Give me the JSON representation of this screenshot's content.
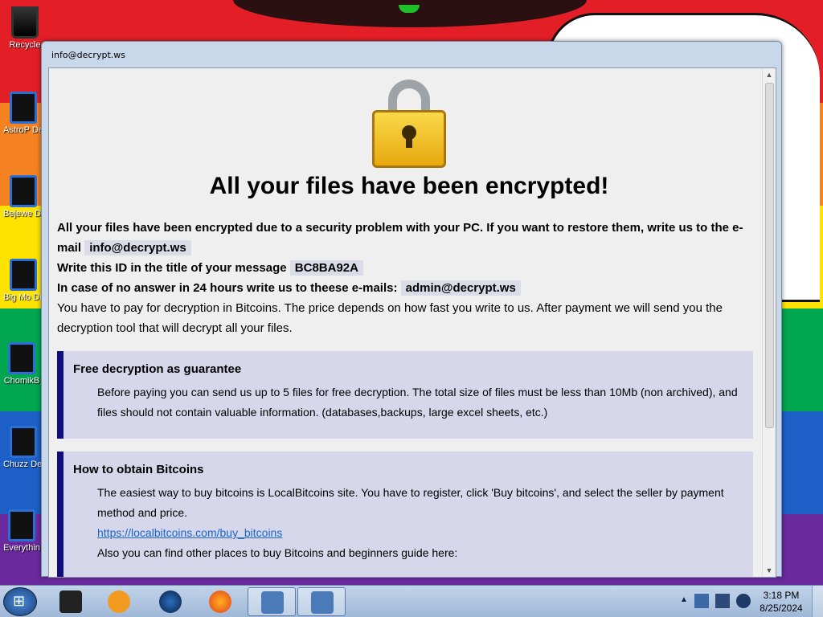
{
  "colors": {
    "wallpaper_stripes": [
      "#e41e26",
      "#f58220",
      "#ffe300",
      "#00a650",
      "#1c5fc6",
      "#6a2a9e"
    ],
    "panel_bg": "#d6d7ea",
    "panel_accent": "#0f0f80",
    "link": "#1b66c9"
  },
  "desktop": {
    "icons": [
      {
        "name": "Recycle",
        "icon": "recycle-bin-icon"
      },
      {
        "name": "AstroP Deluxe.lr",
        "icon": "app-icon"
      },
      {
        "name": "Bejewe Deluxe.lr",
        "icon": "app-icon"
      },
      {
        "name": "Big Mo Deluxe.lr",
        "icon": "app-icon"
      },
      {
        "name": "ChomikB",
        "icon": "app-icon"
      },
      {
        "name": "Chuzz Deluxe.lr",
        "icon": "app-icon"
      },
      {
        "name": "Everythin",
        "icon": "app-icon"
      }
    ]
  },
  "window": {
    "title": "info@decrypt.ws",
    "heading": "All your files have been encrypted!",
    "intro": {
      "line1_text": "All your files have been encrypted due to a security problem with your PC. If you want to restore them, write us to the e-mail",
      "email_primary": "info@decrypt.ws",
      "line2_text": "Write this ID in the title of your message",
      "id_value": "BC8BA92A",
      "line3_text": "In case of no answer in 24 hours write us to theese e-mails:",
      "email_secondary": "admin@decrypt.ws",
      "line4_text": "You have to pay for decryption in Bitcoins. The price depends on how fast you write to us. After payment we will send you the decryption tool that will decrypt all your files."
    },
    "panels": [
      {
        "title": "Free decryption as guarantee",
        "body": "Before paying you can send us up to 5 files for free decryption. The total size of files must be less than 10Mb (non archived), and files should not contain valuable information. (databases,backups, large excel sheets, etc.)"
      },
      {
        "title": "How to obtain Bitcoins",
        "body": "The easiest way to buy bitcoins is LocalBitcoins site. You have to register, click 'Buy bitcoins', and select the seller by payment method and price.",
        "link": "https://localbitcoins.com/buy_bitcoins",
        "body2": "Also you can find other places to buy Bitcoins and beginners guide here:"
      }
    ]
  },
  "taskbar": {
    "apps": [
      "start-orb-icon",
      "terminal-icon",
      "media-player-icon",
      "globe-icon",
      "firefox-icon",
      "network-app-icon",
      "network-app-icon"
    ],
    "time": "3:18 PM",
    "date": "8/25/2024"
  }
}
